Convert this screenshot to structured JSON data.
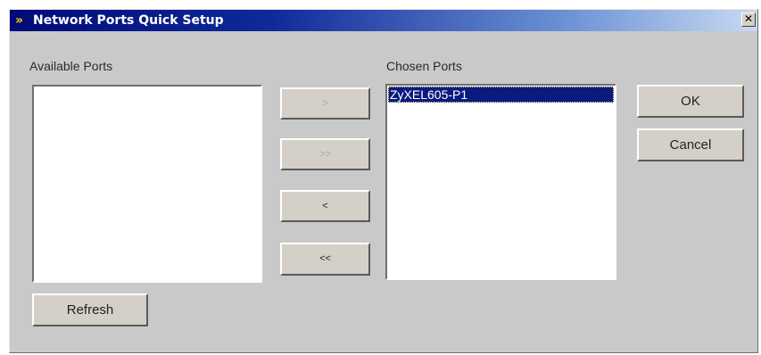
{
  "window": {
    "title": "Network Ports Quick Setup",
    "title_icon": "»",
    "close_label": "✕"
  },
  "available": {
    "label": "Available Ports",
    "items": []
  },
  "chosen": {
    "label": "Chosen Ports",
    "items": [
      {
        "label": "ZyXEL605-P1",
        "selected": true
      }
    ]
  },
  "transfer_buttons": {
    "add": {
      "label": ">",
      "enabled": false
    },
    "add_all": {
      "label": ">>",
      "enabled": false
    },
    "remove": {
      "label": "<",
      "enabled": true
    },
    "remove_all": {
      "label": "<<",
      "enabled": true
    }
  },
  "actions": {
    "ok": "OK",
    "cancel": "Cancel",
    "refresh": "Refresh"
  },
  "colors": {
    "titlebar_start": "#000a78",
    "titlebar_end": "#c8daf2",
    "selection_bg": "#0a1a7e",
    "dialog_bg": "#c9c9c9",
    "title_icon": "#ffd200"
  }
}
